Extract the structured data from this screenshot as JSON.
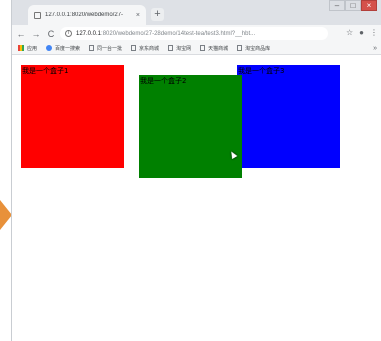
{
  "browser": {
    "tab": {
      "title": "127.0.0.1:8020/webdemo/27-",
      "close_glyph": "×"
    },
    "new_tab_glyph": "+",
    "window_controls": {
      "minimize": "–",
      "maximize": "□",
      "close": "×"
    },
    "nav": {
      "back": "←",
      "forward": "→",
      "reload": "C"
    },
    "address": {
      "info_glyph": "i",
      "host": "127.0.0.1",
      "path": ":8020/webdemo/27-28demo/14test-tea/test3.html?__hbt..."
    },
    "toolbar_icons": {
      "star": "☆",
      "account": "●",
      "menu": "⋮"
    },
    "bookmarks": [
      {
        "label": "应用",
        "icon": "apps-icon"
      },
      {
        "label": "百度一搜索",
        "icon": "globe-icon"
      },
      {
        "label": "同一台一批",
        "icon": "page-icon"
      },
      {
        "label": "京东商城",
        "icon": "page-icon"
      },
      {
        "label": "淘宝网",
        "icon": "page-icon"
      },
      {
        "label": "天猫商城",
        "icon": "page-icon"
      },
      {
        "label": "淘宝商品库",
        "icon": "page-icon"
      }
    ],
    "bookmarks_more": "»"
  },
  "page": {
    "boxes": [
      {
        "label": "我是一个盒子1",
        "color": "#ff0000"
      },
      {
        "label": "我是一个盒子2",
        "color": "#008000"
      },
      {
        "label": "我是一个盒子3",
        "color": "#0000ff"
      }
    ]
  },
  "colors": {
    "tabstrip": "#dee1e6",
    "toolbar": "#f5f6f7",
    "edge_arrow": "#e8913a"
  }
}
